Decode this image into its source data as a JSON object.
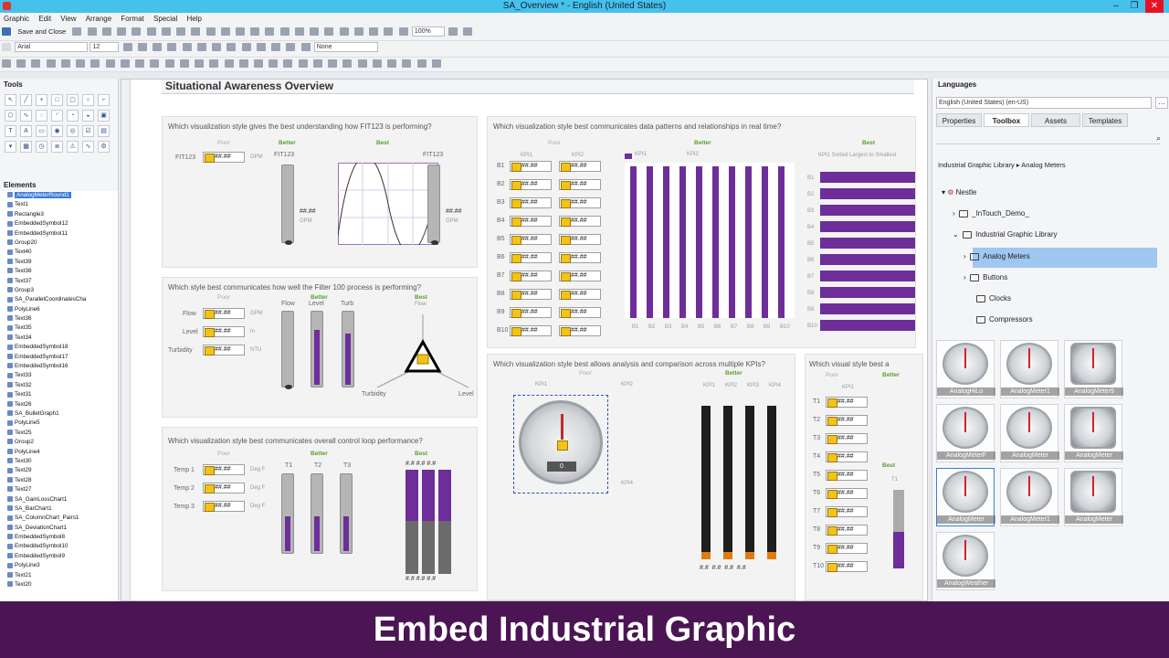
{
  "window": {
    "title": "SA_Overview * - English (United States)",
    "min": "–",
    "max": "❐",
    "close": "✕"
  },
  "menu": [
    "Graphic",
    "Edit",
    "View",
    "Arrange",
    "Format",
    "Special",
    "Help"
  ],
  "toolbar": {
    "save_close": "Save and Close",
    "zoom": "100%",
    "font": "Arial",
    "size": "12",
    "line": "None"
  },
  "tools_title": "Tools",
  "elements_title": "Elements",
  "elements": [
    "AnalogMeterRound1",
    "Text1",
    "Rectangle3",
    "EmbeddedSymbol12",
    "EmbeddedSymbol11",
    "Group20",
    "Text40",
    "Text39",
    "Text38",
    "Text37",
    "Group3",
    "SA_ParallelCoordinatesCha",
    "PolyLine6",
    "Text36",
    "Text35",
    "Text34",
    "EmbeddedSymbol18",
    "EmbeddedSymbol17",
    "EmbeddedSymbol16",
    "Text33",
    "Text32",
    "Text31",
    "Text26",
    "SA_BulletGraph1",
    "PolyLine5",
    "Text25",
    "Group2",
    "PolyLine4",
    "Text30",
    "Text29",
    "Text28",
    "Text27",
    "SA_GainLossChart1",
    "SA_BarChart1",
    "SA_ColumnChart_Pairs1",
    "SA_DeviationChart1",
    "EmbeddedSymbol8",
    "EmbeddedSymbol10",
    "EmbeddedSymbol9",
    "PolyLine3",
    "Text21",
    "Text20"
  ],
  "page_title": "Situational Awareness Overview",
  "panels": {
    "p1": {
      "q": "Which visualization style gives the best understanding how FIT123 is performing?",
      "poor": "Poor",
      "better": "Better",
      "best": "Best",
      "tag": "FIT123",
      "tag2": "FIT123",
      "unit": "GPM",
      "val": "##.##",
      "fld": "##.##"
    },
    "p2": {
      "q": "Which style best communicates how well the Filter 100 process is performing?",
      "poor": "Poor",
      "better": "Better",
      "best": "Best",
      "rows": [
        "Flow",
        "Level",
        "Turbidity"
      ],
      "units": [
        "GPM",
        "In",
        "NTU"
      ],
      "cols": [
        "Flow",
        "Level",
        "Turb"
      ],
      "tri_top": "Flow",
      "tri_left": "Turbidity",
      "tri_right": "Level",
      "fld": "##.##"
    },
    "p3": {
      "q": "Which visualization style best communicates overall control loop performance?",
      "poor": "Poor",
      "better": "Better",
      "best": "Best",
      "rows": [
        "Temp 1",
        "Temp 2",
        "Temp 3"
      ],
      "unit": "Deg F",
      "cols": [
        "T1",
        "T2",
        "T3"
      ],
      "fld": "##.##",
      "hash": "#.#"
    },
    "p4": {
      "q": "Which visualization style best communicates data patterns and relationships in real time?",
      "poor": "Poor",
      "better": "Better",
      "best": "Best",
      "kpi1": "KPI1",
      "kpi2": "KPI2",
      "rows": [
        "B1",
        "B2",
        "B3",
        "B4",
        "B5",
        "B6",
        "B7",
        "B8",
        "B9",
        "B10"
      ],
      "fld": "##.##",
      "sorted": "KPI1 Sorted Largest to Smallest"
    },
    "p5": {
      "q": "Which visualization style best allows analysis and comparison across multiple KPIs?",
      "poor": "Poor",
      "better": "Better",
      "kpis": [
        "KPI1",
        "KPI2",
        "KPI3",
        "KPI4"
      ],
      "gauge_val": "0",
      "hash": "#.#"
    },
    "p6": {
      "q": "Which visual style best a",
      "poor": "Poor",
      "better": "Better",
      "best": "Best",
      "kpi1": "KPI1",
      "rows": [
        "T1",
        "T2",
        "T3",
        "T4",
        "T5",
        "T6",
        "T7",
        "T8",
        "T9",
        "T10"
      ],
      "fld": "##.##",
      "t1": "T1"
    }
  },
  "right": {
    "languages": "Languages",
    "lang_sel": "English (United States) (en-US)",
    "tabs": [
      "Properties",
      "Toolbox",
      "Assets",
      "Templates"
    ],
    "breadcrumb": "Industrial Graphic Library ▸ Analog Meters",
    "tree": [
      "Nestle",
      "_InTouch_Demo_",
      "Industrial Graphic Library",
      "Analog Meters",
      "Buttons",
      "Clocks",
      "Compressors"
    ],
    "thumbs": [
      "AnalogHiLo",
      "AnalogMeter1",
      "AnalogMeter9",
      "AnalogMeterF",
      "AnalogMeter",
      "AnalogMeter",
      "AnalogMeter",
      "AnalogMeter1",
      "AnalogMeter",
      "AnalogWeather"
    ]
  },
  "banner": "Embed Industrial Graphic",
  "colors": {
    "purple": "#6d2e99",
    "accent": "#46c1ec",
    "banner": "#4a1552",
    "green": "#5aa02c"
  }
}
